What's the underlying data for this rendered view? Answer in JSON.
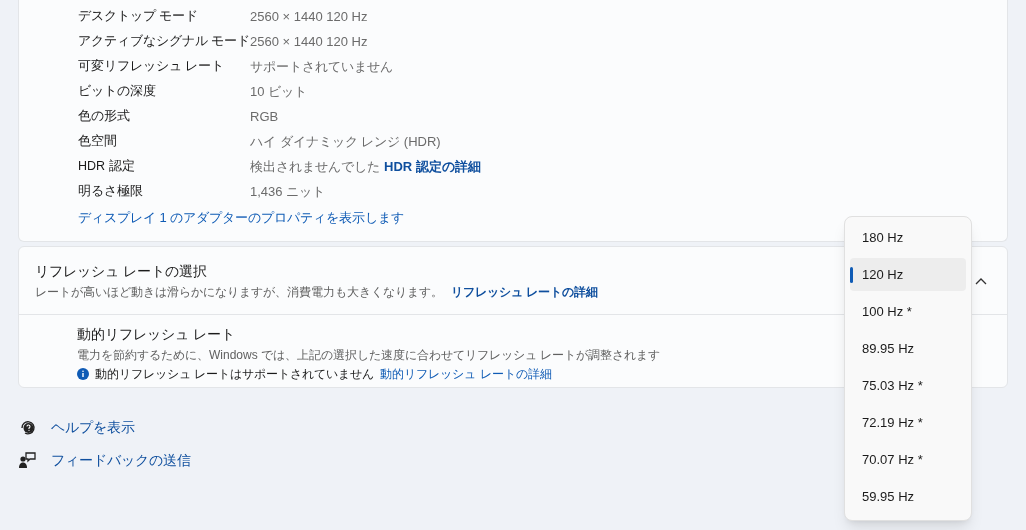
{
  "display_info": {
    "rows": [
      {
        "label": "デスクトップ モード",
        "value": "2560 × 1440 120 Hz"
      },
      {
        "label": "アクティブなシグナル モード",
        "value": "2560 × 1440 120 Hz"
      },
      {
        "label": "可変リフレッシュ レート",
        "value": "サポートされていません"
      },
      {
        "label": "ビットの深度",
        "value": "10 ビット"
      },
      {
        "label": "色の形式",
        "value": "RGB"
      },
      {
        "label": "色空間",
        "value": "ハイ ダイナミック レンジ (HDR)"
      },
      {
        "label": "HDR 認定",
        "value": "検出されませんでした",
        "link": "HDR 認定の詳細"
      },
      {
        "label": "明るさ極限",
        "value": "1,436 ニット"
      }
    ],
    "adapter_link": "ディスプレイ 1 のアダプターのプロパティを表示します"
  },
  "refresh_rate": {
    "title": "リフレッシュ レートの選択",
    "description": "レートが高いほど動きは滑らかになりますが、消費電力も大きくなります。",
    "link": "リフレッシュ レートの詳細",
    "expanded": true,
    "dynamic": {
      "title": "動的リフレッシュ レート",
      "description": "電力を節約するために、Windows では、上記の選択した速度に合わせてリフレッシュ レートが調整されます",
      "info": "動的リフレッシュ レートはサポートされていません",
      "link": "動的リフレッシュ レートの詳細"
    }
  },
  "footer_links": [
    {
      "kind": "help",
      "label": "ヘルプを表示"
    },
    {
      "kind": "feedback",
      "label": "フィードバックの送信"
    }
  ],
  "dropdown": {
    "options": [
      {
        "label": "180 Hz",
        "selected": false
      },
      {
        "label": "120 Hz",
        "selected": true
      },
      {
        "label": "100 Hz *",
        "selected": false
      },
      {
        "label": "89.95 Hz",
        "selected": false
      },
      {
        "label": "75.03 Hz *",
        "selected": false
      },
      {
        "label": "72.19 Hz *",
        "selected": false
      },
      {
        "label": "70.07 Hz *",
        "selected": false
      },
      {
        "label": "59.95 Hz",
        "selected": false
      }
    ]
  }
}
